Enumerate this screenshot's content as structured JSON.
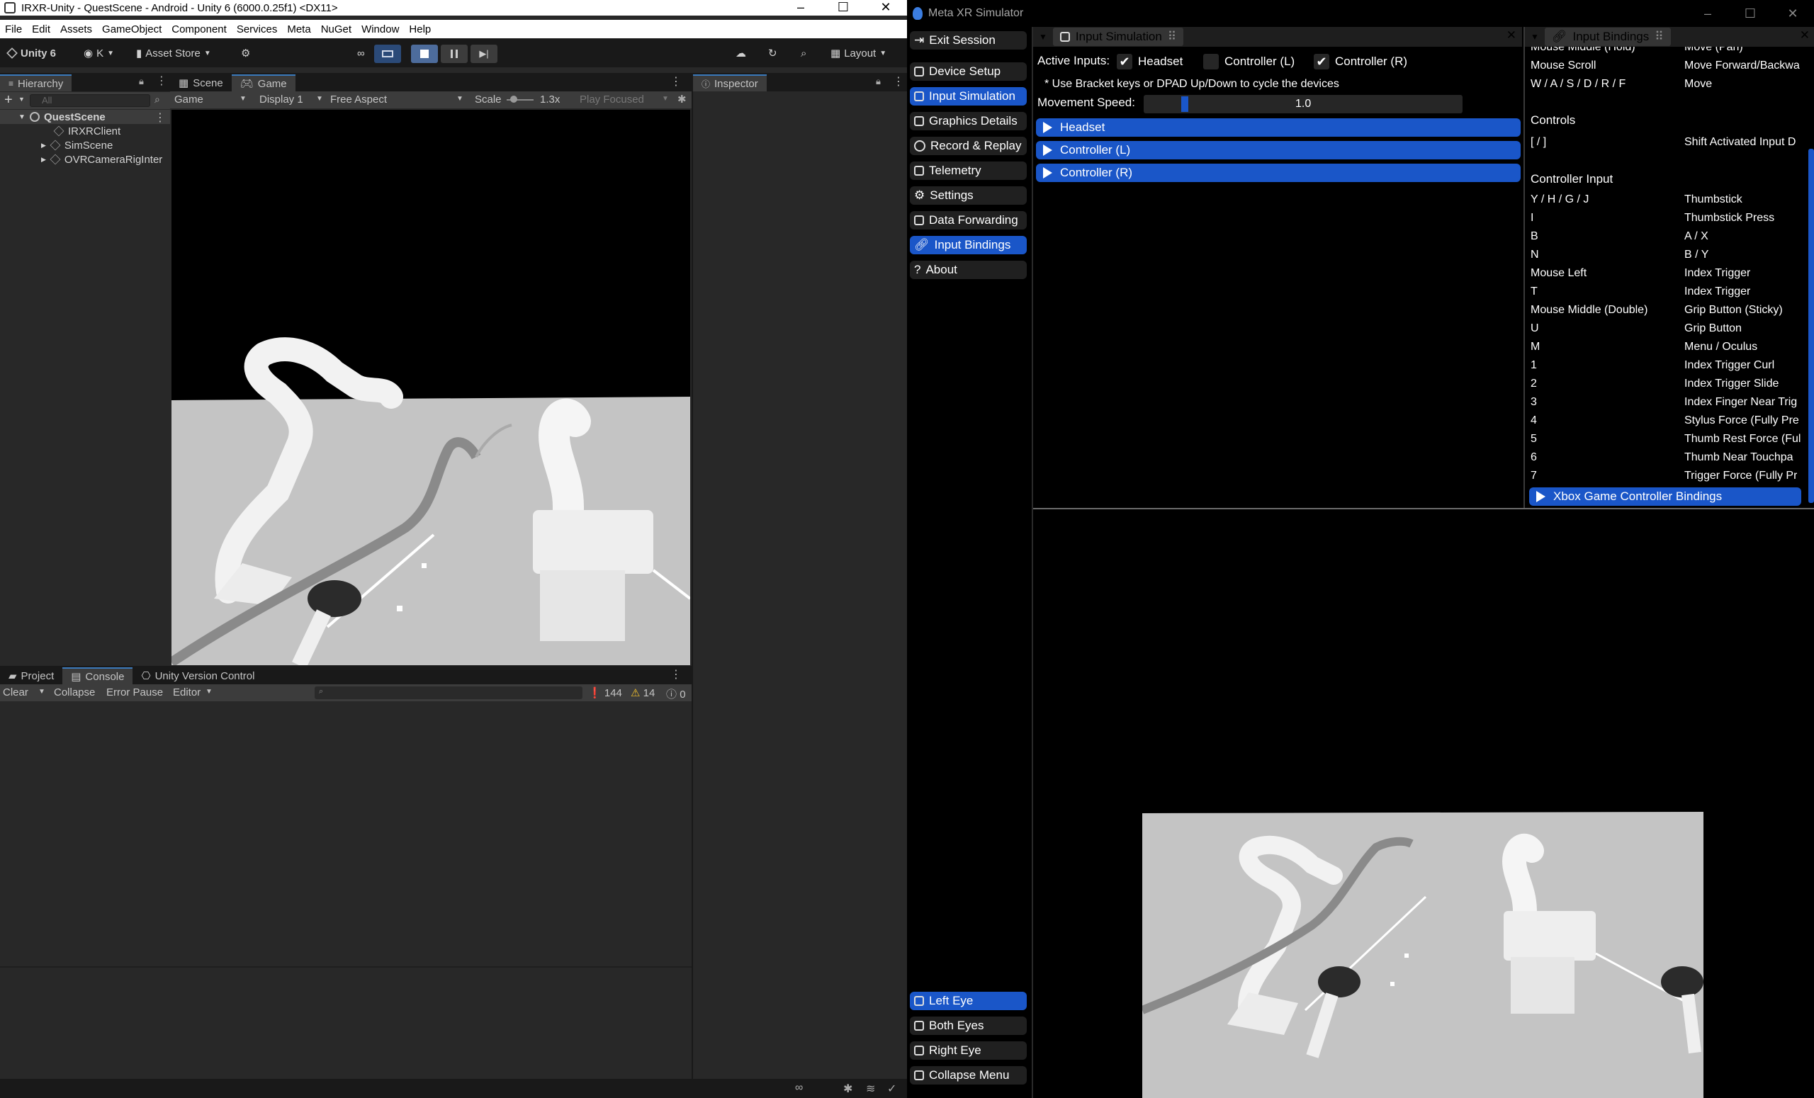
{
  "unity": {
    "title": "IRXR-Unity - QuestScene - Android - Unity 6 (6000.0.25f1) <DX11>",
    "menu": [
      "File",
      "Edit",
      "Assets",
      "GameObject",
      "Component",
      "Services",
      "Meta",
      "NuGet",
      "Window",
      "Help"
    ],
    "toolbar": {
      "unity_label": "Unity 6",
      "account_label": "K",
      "asset_store_label": "Asset Store",
      "layout_label": "Layout"
    },
    "hierarchy": {
      "tab": "Hierarchy",
      "search_placeholder": "All",
      "scene": "QuestScene",
      "items": [
        "IRXRClient",
        "SimScene",
        "OVRCameraRigInter"
      ]
    },
    "view_tabs": {
      "scene": "Scene",
      "game": "Game"
    },
    "game_toolbar": {
      "mode": "Game",
      "display": "Display 1",
      "aspect": "Free Aspect",
      "scale_label": "Scale",
      "scale_value": "1.3x",
      "play_mode": "Play Focused"
    },
    "inspector_tab": "Inspector",
    "bottom_tabs": {
      "project": "Project",
      "console": "Console",
      "vcs": "Unity Version Control"
    },
    "console_toolbar": {
      "clear": "Clear",
      "collapse": "Collapse",
      "error_pause": "Error Pause",
      "editor": "Editor",
      "log_count": "144",
      "warn_count": "14",
      "error_count": "0"
    }
  },
  "meta": {
    "title": "Meta XR Simulator",
    "sidebar": {
      "items": [
        "Exit Session",
        "Device Setup",
        "Input Simulation",
        "Graphics Details",
        "Record & Replay",
        "Telemetry",
        "Settings",
        "Data Forwarding",
        "Input Bindings",
        "About"
      ],
      "bottom_items": [
        "Left Eye",
        "Both Eyes",
        "Right Eye",
        "Collapse Menu"
      ]
    },
    "input_sim": {
      "tab": "Input Simulation",
      "active_inputs_label": "Active Inputs:",
      "headset_label": "Headset",
      "controller_l_label": "Controller (L)",
      "controller_r_label": "Controller (R)",
      "hint": "* Use Bracket keys or DPAD Up/Down to cycle the devices",
      "speed_label": "Movement Speed:",
      "speed_value": "1.0",
      "speed_fraction": 0.05,
      "sections": [
        "Headset",
        "Controller (L)",
        "Controller (R)"
      ]
    },
    "bindings": {
      "tab": "Input Bindings",
      "top_rows": [
        {
          "key": "Mouse Middle (Hold)",
          "val": "Move (Pan)"
        },
        {
          "key": "Mouse Scroll",
          "val": "Move Forward/Backwa"
        },
        {
          "key": "W / A / S / D / R / F",
          "val": "Move"
        }
      ],
      "controls_heading": "Controls",
      "controls_rows": [
        {
          "key": "[ / ]",
          "val": "Shift Activated Input D"
        }
      ],
      "controller_heading": "Controller Input",
      "controller_rows": [
        {
          "key": "Y / H / G / J",
          "val": "Thumbstick"
        },
        {
          "key": "I",
          "val": "Thumbstick Press"
        },
        {
          "key": "B",
          "val": "A / X"
        },
        {
          "key": "N",
          "val": "B / Y"
        },
        {
          "key": "Mouse Left",
          "val": "Index Trigger"
        },
        {
          "key": "T",
          "val": "Index Trigger"
        },
        {
          "key": "Mouse Middle (Double)",
          "val": "Grip Button (Sticky)"
        },
        {
          "key": "U",
          "val": "Grip Button"
        },
        {
          "key": "M",
          "val": "Menu / Oculus"
        },
        {
          "key": "1",
          "val": "Index Trigger Curl"
        },
        {
          "key": "2",
          "val": "Index Trigger Slide"
        },
        {
          "key": "3",
          "val": "Index Finger Near Trig"
        },
        {
          "key": "4",
          "val": "Stylus Force (Fully Pre"
        },
        {
          "key": "5",
          "val": "Thumb Rest Force (Ful"
        },
        {
          "key": "6",
          "val": "Thumb Near Touchpa"
        },
        {
          "key": "7",
          "val": "Trigger Force (Fully Pr"
        }
      ],
      "xbox_section": "Xbox Game Controller Bindings"
    }
  },
  "colors": {
    "accent_blue": "#1a56c8",
    "unity_bg": "#282828",
    "floor": "#c3c3c3"
  }
}
